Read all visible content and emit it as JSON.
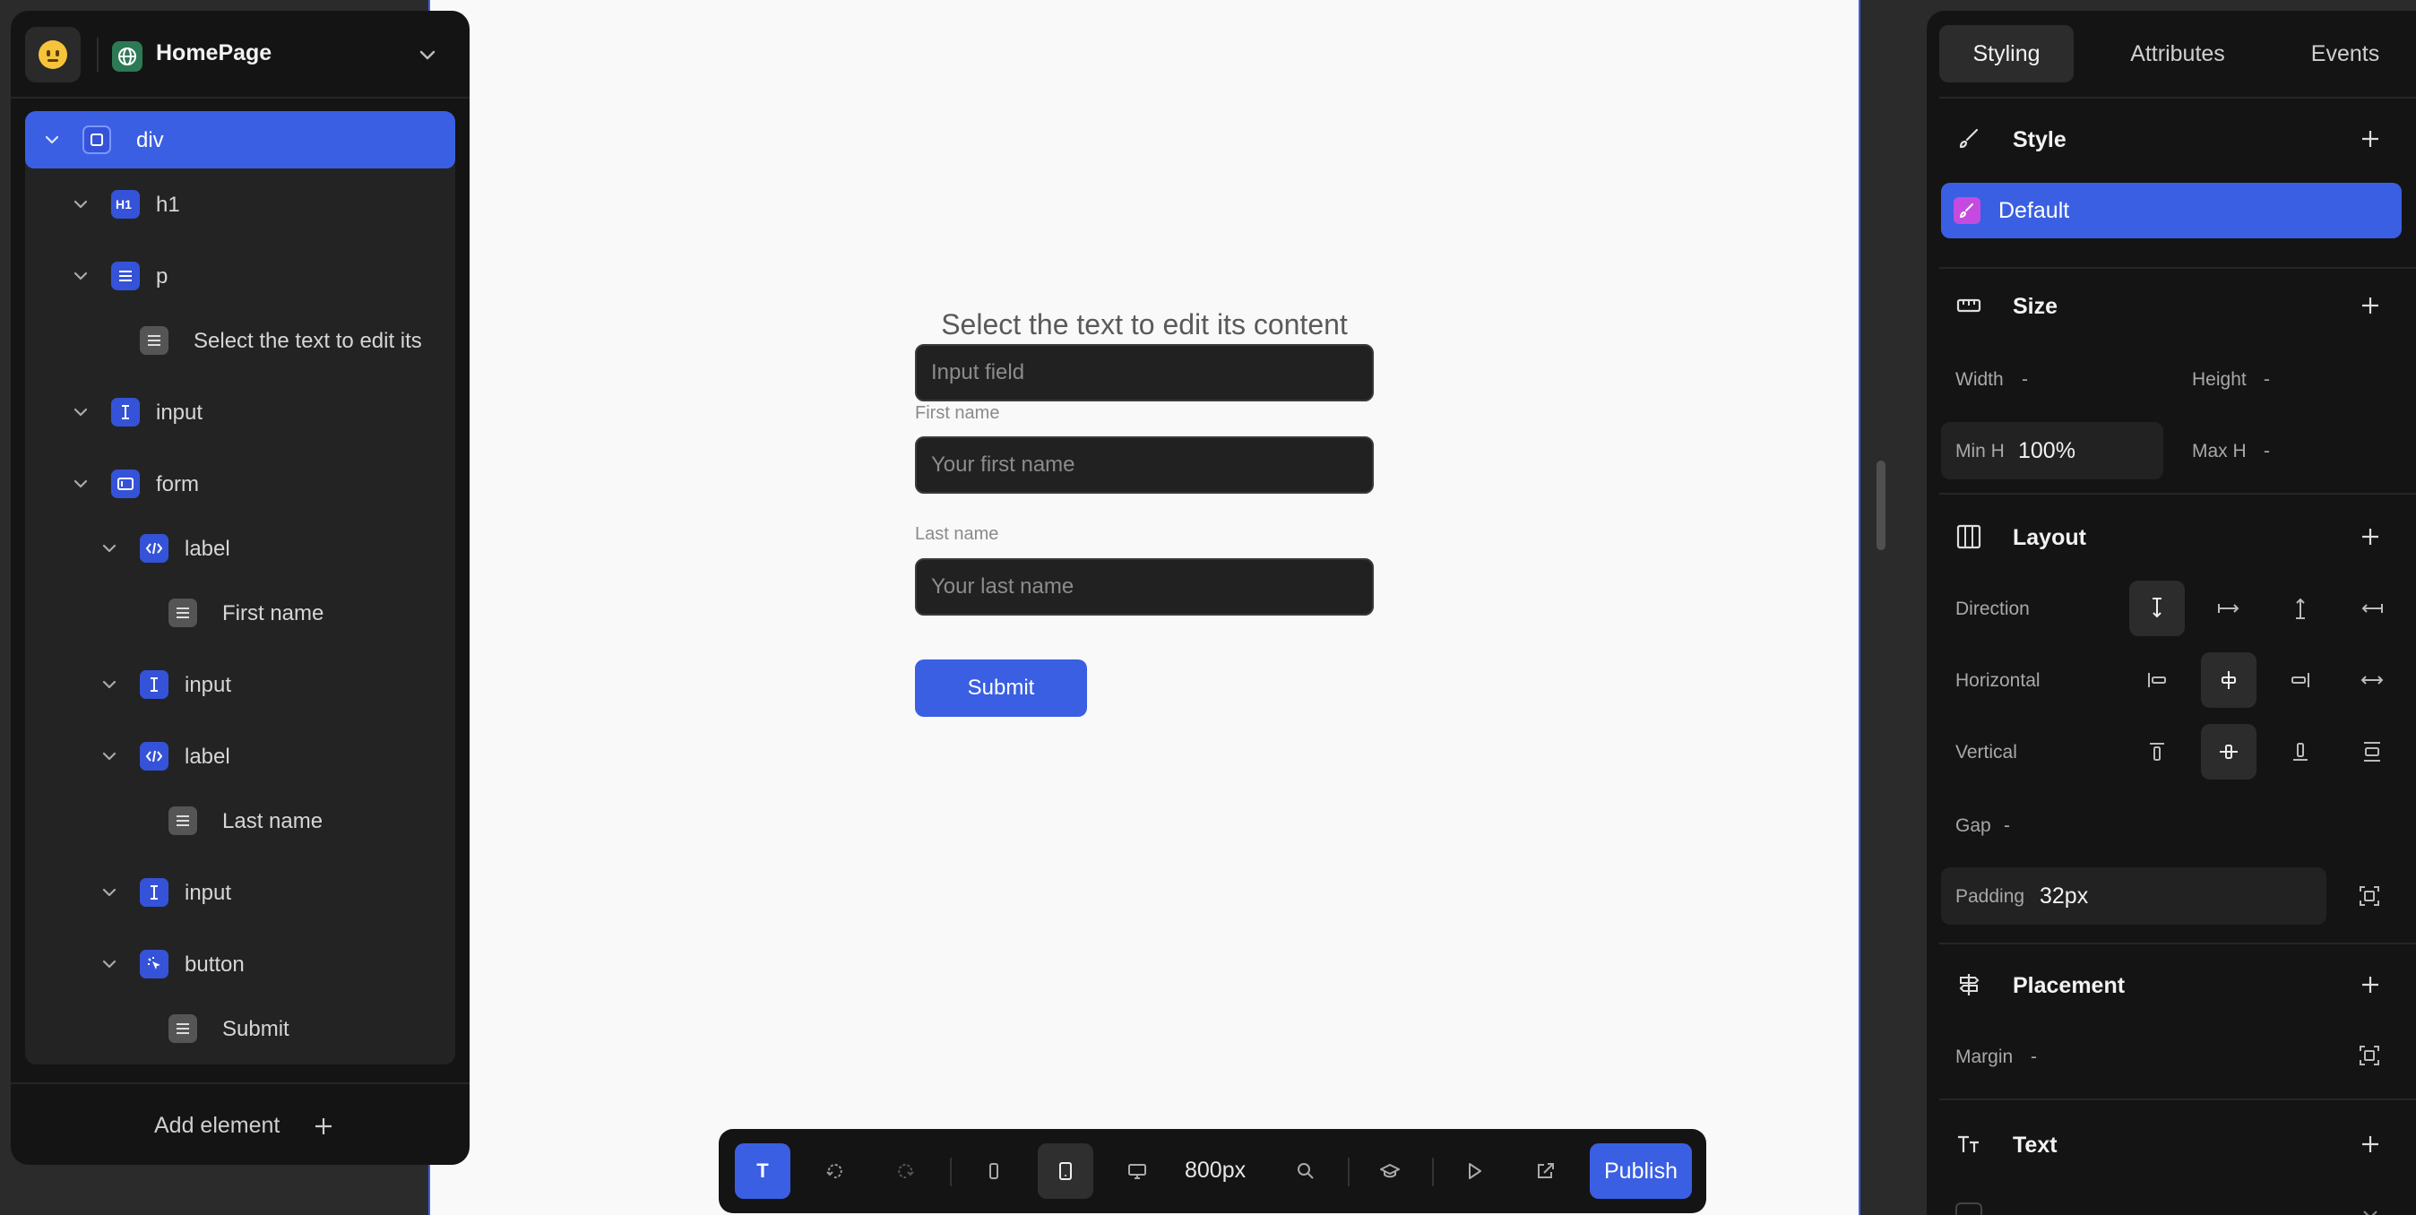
{
  "left_panel": {
    "page_name": "HomePage",
    "add_element_label": "Add element",
    "tree": [
      {
        "label": "div"
      },
      {
        "label": "h1",
        "icon_text": "H1"
      },
      {
        "label": "p"
      },
      {
        "label": "Select the text to edit its"
      },
      {
        "label": "input"
      },
      {
        "label": "form"
      },
      {
        "label": "label"
      },
      {
        "label": "First name"
      },
      {
        "label": "input"
      },
      {
        "label": "label"
      },
      {
        "label": "Last name"
      },
      {
        "label": "input"
      },
      {
        "label": "button"
      },
      {
        "label": "Submit"
      }
    ]
  },
  "canvas": {
    "title": "Select the text to edit its content",
    "input_placeholder": "Input field",
    "first_name_label": "First name",
    "first_name_placeholder": "Your first name",
    "last_name_label": "Last name",
    "last_name_placeholder": "Your last name",
    "submit_label": "Submit"
  },
  "toolbar": {
    "text_tool_glyph": "T",
    "width_label": "800px",
    "publish_label": "Publish"
  },
  "right_panel": {
    "tabs": [
      "Styling",
      "Attributes",
      "Events"
    ],
    "style": {
      "title": "Style",
      "default_label": "Default"
    },
    "size": {
      "title": "Size",
      "width_label": "Width",
      "width_value": "-",
      "height_label": "Height",
      "height_value": "-",
      "min_h_label": "Min H",
      "min_h_value": "100%",
      "max_h_label": "Max H",
      "max_h_value": "-"
    },
    "layout": {
      "title": "Layout",
      "direction_label": "Direction",
      "horizontal_label": "Horizontal",
      "vertical_label": "Vertical",
      "gap_label": "Gap",
      "gap_value": "-",
      "padding_label": "Padding",
      "padding_value": "32px"
    },
    "placement": {
      "title": "Placement",
      "margin_label": "Margin",
      "margin_value": "-"
    },
    "text": {
      "title": "Text"
    }
  }
}
